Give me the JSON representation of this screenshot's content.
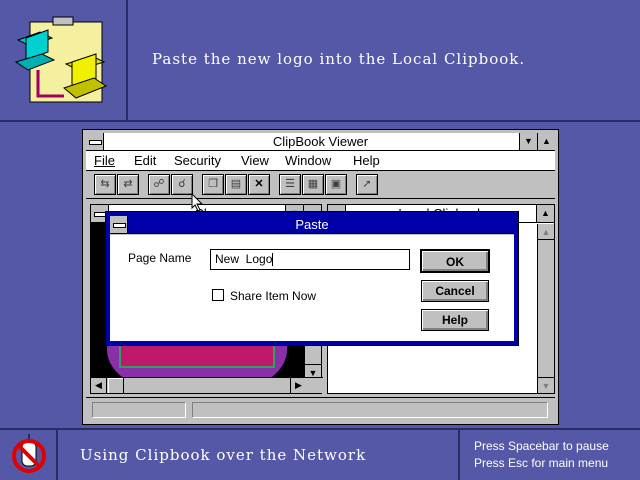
{
  "banner": {
    "instruction": "Paste the new logo into the Local Clipbook."
  },
  "window": {
    "title": "ClipBook Viewer",
    "menu": [
      "File",
      "Edit",
      "Security",
      "View",
      "Window",
      "Help"
    ],
    "toolbar_icons": [
      "connect-icon",
      "disconnect-icon",
      "share-icon",
      "stop-sharing-icon",
      "copy-icon",
      "paste-icon",
      "delete-icon",
      "table-of-contents-icon",
      "thumbnails-icon",
      "full-page-icon",
      "help-pointer-icon"
    ]
  },
  "left_child": {
    "title": "Cl..."
  },
  "right_child": {
    "title": "Local Clipbook"
  },
  "dialog": {
    "title": "Paste",
    "page_name_label": "Page Name",
    "page_name_value": "New  Logo",
    "share_label": "Share Item Now",
    "share_checked": false,
    "ok_label": "OK",
    "cancel_label": "Cancel",
    "help_label": "Help"
  },
  "bottom": {
    "subtitle": "Using Clipbook over the Network",
    "help_line1": "Press Spacebar to pause",
    "help_line2": "Press Esc for main menu"
  },
  "colors": {
    "desktop": "#5558a6",
    "active_title": "#0000a8",
    "chrome": "#c0c0c0"
  }
}
